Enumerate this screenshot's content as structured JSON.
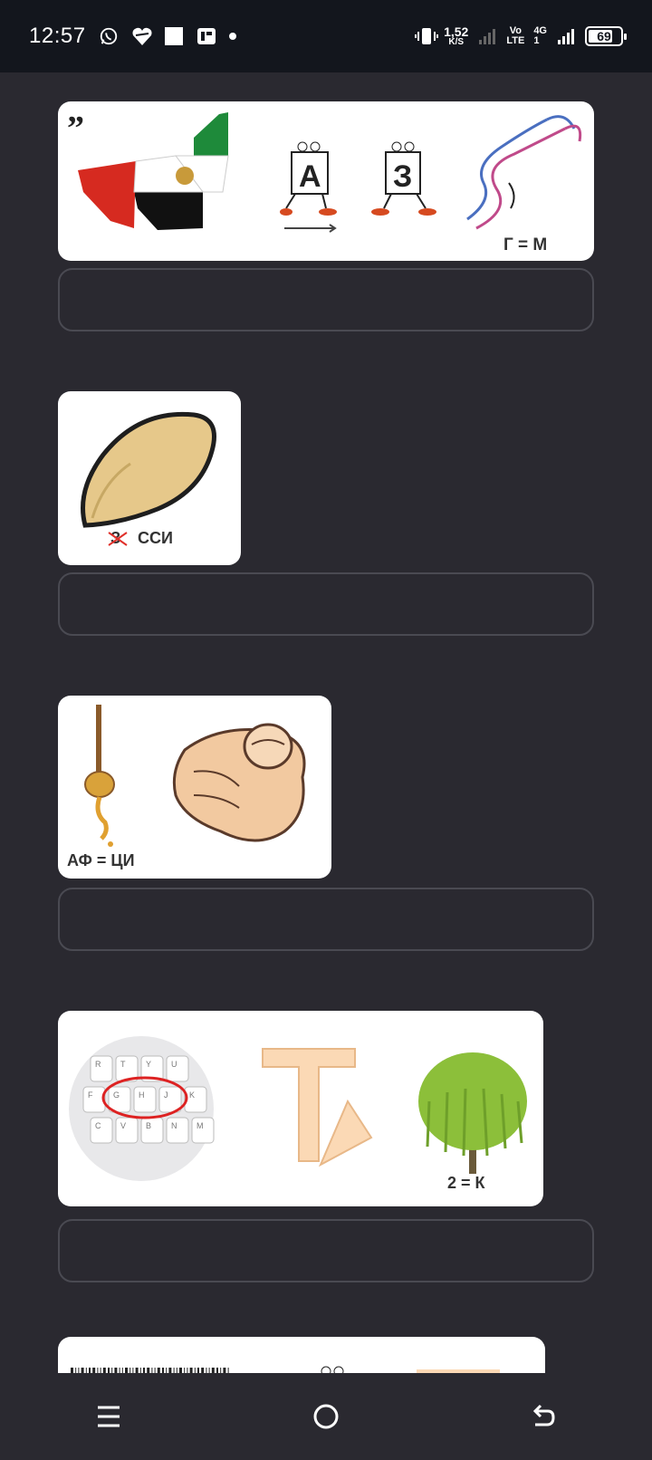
{
  "status_bar": {
    "time": "12:57",
    "speed_value": "1,52",
    "speed_unit": "K/S",
    "volte_top": "Vo",
    "volte_bottom": "LTE",
    "network": "4G",
    "network_sub": "1",
    "battery": "69"
  },
  "puzzles": [
    {
      "hint": "Г = М",
      "answer_value": ""
    },
    {
      "hint": "СCИ",
      "struck": "З",
      "answer_value": ""
    },
    {
      "hint": "АФ = ЦИ",
      "answer_value": ""
    },
    {
      "hint": "2 = К",
      "answer_value": ""
    }
  ],
  "puzzle1": {
    "letter_a": "А",
    "letter_z": "З"
  },
  "puzzle4": {
    "key_labels": [
      "R",
      "T",
      "Y",
      "U",
      "F",
      "G",
      "H",
      "J",
      "K",
      "C",
      "V",
      "B",
      "N",
      "M"
    ]
  },
  "colors": {
    "background": "#2a2930",
    "status_bar": "#13161d",
    "card": "#ffffff",
    "input_border": "#4a4a52"
  }
}
